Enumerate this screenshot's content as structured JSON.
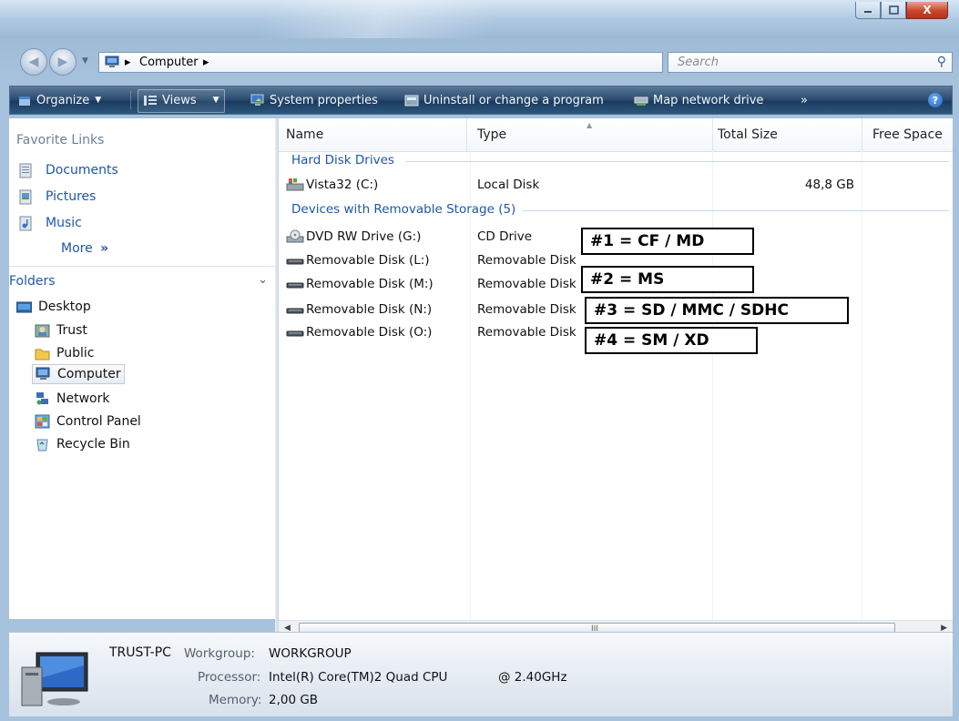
{
  "window": {
    "caption_buttons": {
      "minimize": "minimize-icon",
      "maximize": "maximize-icon",
      "close": "X"
    }
  },
  "address_bar": {
    "breadcrumb": [
      "Computer"
    ],
    "separator": "▸",
    "search_placeholder": "Search"
  },
  "command_bar": {
    "items": [
      {
        "label": "Organize",
        "icon": "organize-icon",
        "dropdown": true
      },
      {
        "label": "Views",
        "icon": "views-icon",
        "dropdown": true
      },
      {
        "label": "System properties",
        "icon": "system-properties-icon"
      },
      {
        "label": "Uninstall or change a program",
        "icon": "uninstall-icon"
      },
      {
        "label": "Map network drive",
        "icon": "map-drive-icon"
      }
    ],
    "overflow": "»",
    "help": "?"
  },
  "navigation_pane": {
    "favorite_links_title": "Favorite Links",
    "favorites": [
      {
        "label": "Documents",
        "icon": "documents-icon"
      },
      {
        "label": "Pictures",
        "icon": "pictures-icon"
      },
      {
        "label": "Music",
        "icon": "music-icon"
      }
    ],
    "more_label": "More",
    "more_chevron": "»",
    "folders_title": "Folders",
    "folders_chevron": "⌄",
    "tree": [
      {
        "label": "Desktop",
        "icon": "desktop-icon",
        "level": 0
      },
      {
        "label": "Trust",
        "icon": "user-folder-icon",
        "level": 1
      },
      {
        "label": "Public",
        "icon": "folder-icon",
        "level": 1
      },
      {
        "label": "Computer",
        "icon": "computer-icon",
        "level": 1,
        "selected": true
      },
      {
        "label": "Network",
        "icon": "network-icon",
        "level": 1
      },
      {
        "label": "Control Panel",
        "icon": "control-panel-icon",
        "level": 1
      },
      {
        "label": "Recycle Bin",
        "icon": "recycle-bin-icon",
        "level": 1
      }
    ]
  },
  "file_list": {
    "columns": [
      "Name",
      "Type",
      "Total Size",
      "Free Space"
    ],
    "groups": [
      {
        "title": "Hard Disk Drives",
        "rows": [
          {
            "name": "Vista32 (C:)",
            "type": "Local Disk",
            "total": "48,8 GB",
            "free": "",
            "icon": "hard-disk-icon"
          }
        ]
      },
      {
        "title": "Devices with Removable Storage (5)",
        "rows": [
          {
            "name": "DVD RW Drive (G:)",
            "type": "CD Drive",
            "total": "",
            "free": "",
            "icon": "dvd-drive-icon"
          },
          {
            "name": "Removable Disk (L:)",
            "type": "Removable Disk",
            "total": "",
            "free": "",
            "icon": "removable-disk-icon"
          },
          {
            "name": "Removable Disk (M:)",
            "type": "Removable Disk",
            "total": "",
            "free": "",
            "icon": "removable-disk-icon"
          },
          {
            "name": "Removable Disk (N:)",
            "type": "Removable Disk",
            "total": "",
            "free": "",
            "icon": "removable-disk-icon"
          },
          {
            "name": "Removable Disk (O:)",
            "type": "Removable Disk",
            "total": "",
            "free": "",
            "icon": "removable-disk-icon"
          }
        ]
      }
    ],
    "scrollbar_grip": "III"
  },
  "annotations": [
    "#1 = CF / MD",
    "#2 = MS",
    "#3 = SD / MMC / SDHC",
    "#4 = SM / XD"
  ],
  "details_pane": {
    "computer_name": "TRUST-PC",
    "workgroup_label": "Workgroup:",
    "workgroup": "WORKGROUP",
    "processor_label": "Processor:",
    "processor": "Intel(R) Core(TM)2 Quad CPU",
    "processor_speed": "@ 2.40GHz",
    "memory_label": "Memory:",
    "memory": "2,00 GB"
  },
  "colors": {
    "accent": "#1e57a6",
    "command_bar": "#2d4f72",
    "group_header": "#1e57a6"
  }
}
